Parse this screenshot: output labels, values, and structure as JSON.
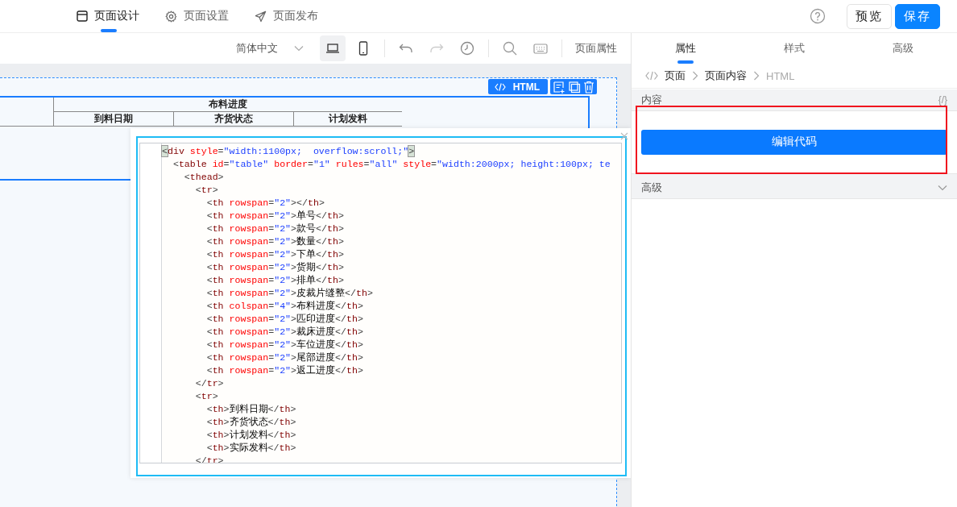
{
  "nav_tabs": [
    {
      "label": "页面设计",
      "selected": true
    },
    {
      "label": "页面设置",
      "selected": false
    },
    {
      "label": "页面发布",
      "selected": false
    }
  ],
  "header_buttons": [
    {
      "label": "预览",
      "kind": "default"
    },
    {
      "label": "保存",
      "kind": "primary"
    }
  ],
  "toolbar": {
    "language": "简体中文",
    "devices": [
      {
        "kind": "desktop",
        "selected": true
      },
      {
        "kind": "mobile",
        "selected": false
      }
    ],
    "history": [
      {
        "kind": "undo",
        "disabled": false
      },
      {
        "kind": "redo",
        "disabled": true
      }
    ],
    "page_properties": "页面属性"
  },
  "canvas": {
    "component_label": "HTML",
    "table": {
      "group_header": "布料进度",
      "sub_headers": [
        "到料日期",
        "齐货状态",
        "计划发料"
      ]
    }
  },
  "code_editor": {
    "lines": [
      {
        "text": "<div style=\"width:1100px;  overflow:scroll;\">",
        "bracket_match": true
      },
      {
        "text": "  <table id=\"table\" border=\"1\" rules=\"all\" style=\"width:2000px; height:100px; te",
        "bracket_match": false
      },
      {
        "text": "    <thead>",
        "bracket_match": false
      },
      {
        "text": "      <tr>",
        "bracket_match": false
      },
      {
        "text": "        <th rowspan=\"2\"></th>",
        "bracket_match": false
      },
      {
        "text": "        <th rowspan=\"2\">单号</th>",
        "bracket_match": false
      },
      {
        "text": "        <th rowspan=\"2\">款号</th>",
        "bracket_match": false
      },
      {
        "text": "        <th rowspan=\"2\">数量</th>",
        "bracket_match": false
      },
      {
        "text": "        <th rowspan=\"2\">下单</th>",
        "bracket_match": false
      },
      {
        "text": "        <th rowspan=\"2\">货期</th>",
        "bracket_match": false
      },
      {
        "text": "        <th rowspan=\"2\">排单</th>",
        "bracket_match": false
      },
      {
        "text": "        <th rowspan=\"2\">皮裁片缝整</th>",
        "bracket_match": false
      },
      {
        "text": "        <th colspan=\"4\">布料进度</th>",
        "bracket_match": false
      },
      {
        "text": "        <th rowspan=\"2\">匹印进度</th>",
        "bracket_match": false
      },
      {
        "text": "        <th rowspan=\"2\">裁床进度</th>",
        "bracket_match": false
      },
      {
        "text": "        <th rowspan=\"2\">车位进度</th>",
        "bracket_match": false
      },
      {
        "text": "        <th rowspan=\"2\">尾部进度</th>",
        "bracket_match": false
      },
      {
        "text": "        <th rowspan=\"2\">返工进度</th>",
        "bracket_match": false
      },
      {
        "text": "      </tr>",
        "bracket_match": false
      },
      {
        "text": "      <tr>",
        "bracket_match": false
      },
      {
        "text": "        <th>到料日期</th>",
        "bracket_match": false
      },
      {
        "text": "        <th>齐货状态</th>",
        "bracket_match": false
      },
      {
        "text": "        <th>计划发料</th>",
        "bracket_match": false
      },
      {
        "text": "        <th>实际发料</th>",
        "bracket_match": false
      },
      {
        "text": "      </tr>",
        "bracket_match": false
      }
    ]
  },
  "panel": {
    "tabs": [
      {
        "label": "属性",
        "selected": true
      },
      {
        "label": "样式",
        "selected": false
      },
      {
        "label": "高级",
        "selected": false
      }
    ],
    "breadcrumb": [
      "页面",
      "页面内容",
      "HTML"
    ],
    "content_section": {
      "title": "内容",
      "expression_toggle": "{/}",
      "button": "编辑代码"
    },
    "advanced_section": {
      "title": "高级",
      "expanded": false
    }
  }
}
